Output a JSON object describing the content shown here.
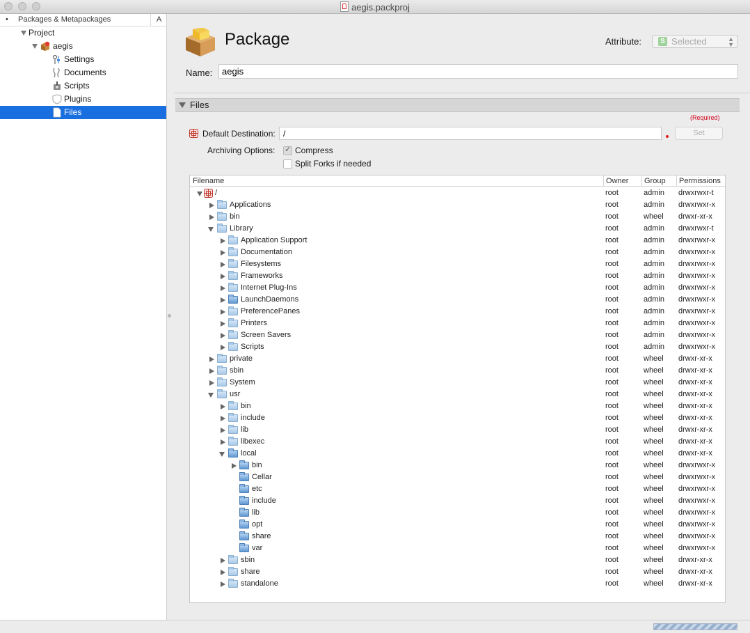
{
  "window": {
    "title": "aegis.packproj"
  },
  "sidebar": {
    "bullet": "•",
    "header": "Packages & Metapackages",
    "sort_label": "A",
    "items": [
      {
        "label": "Project",
        "icon": "disclosure-down"
      },
      {
        "label": "aegis",
        "icon": "package-icon"
      },
      {
        "label": "Settings",
        "icon": "settings-icon"
      },
      {
        "label": "Documents",
        "icon": "documents-icon"
      },
      {
        "label": "Scripts",
        "icon": "scripts-icon"
      },
      {
        "label": "Plugins",
        "icon": "plugins-icon"
      },
      {
        "label": "Files",
        "icon": "file-icon",
        "selected": true
      }
    ]
  },
  "package": {
    "title": "Package",
    "attribute_label": "Attribute:",
    "attribute_badge": "S",
    "attribute_value": "Selected",
    "name_label": "Name:",
    "name_value": "aegis"
  },
  "files": {
    "section_title": "Files",
    "required": "(Required)",
    "default_destination_label": "Default Destination:",
    "default_destination_value": "/",
    "set_button": "Set",
    "archiving_label": "Archiving Options:",
    "compress_label": "Compress",
    "compress_checked": true,
    "split_forks_label": "Split Forks if needed",
    "split_forks_checked": false,
    "columns": {
      "filename": "Filename",
      "owner": "Owner",
      "group": "Group",
      "permissions": "Permissions"
    },
    "rows": [
      {
        "name": "/",
        "level": 0,
        "disc": "down",
        "icon": "root",
        "owner": "root",
        "group": "admin",
        "perm": "drwxrwxr-t"
      },
      {
        "name": "Applications",
        "level": 1,
        "disc": "right",
        "icon": "folder",
        "owner": "root",
        "group": "admin",
        "perm": "drwxrwxr-x"
      },
      {
        "name": "bin",
        "level": 1,
        "disc": "right",
        "icon": "folder",
        "owner": "root",
        "group": "wheel",
        "perm": "drwxr-xr-x"
      },
      {
        "name": "Library",
        "level": 1,
        "disc": "down",
        "icon": "folder",
        "owner": "root",
        "group": "admin",
        "perm": "drwxrwxr-t"
      },
      {
        "name": "Application Support",
        "level": 2,
        "disc": "right",
        "icon": "folder",
        "owner": "root",
        "group": "admin",
        "perm": "drwxrwxr-x"
      },
      {
        "name": "Documentation",
        "level": 2,
        "disc": "right",
        "icon": "folder",
        "owner": "root",
        "group": "admin",
        "perm": "drwxrwxr-x"
      },
      {
        "name": "Filesystems",
        "level": 2,
        "disc": "right",
        "icon": "folder",
        "owner": "root",
        "group": "admin",
        "perm": "drwxrwxr-x"
      },
      {
        "name": "Frameworks",
        "level": 2,
        "disc": "right",
        "icon": "folder",
        "owner": "root",
        "group": "admin",
        "perm": "drwxrwxr-x"
      },
      {
        "name": "Internet Plug-Ins",
        "level": 2,
        "disc": "right",
        "icon": "folder",
        "owner": "root",
        "group": "admin",
        "perm": "drwxrwxr-x"
      },
      {
        "name": "LaunchDaemons",
        "level": 2,
        "disc": "right",
        "icon": "folder-dark",
        "owner": "root",
        "group": "admin",
        "perm": "drwxrwxr-x"
      },
      {
        "name": "PreferencePanes",
        "level": 2,
        "disc": "right",
        "icon": "folder",
        "owner": "root",
        "group": "admin",
        "perm": "drwxrwxr-x"
      },
      {
        "name": "Printers",
        "level": 2,
        "disc": "right",
        "icon": "folder",
        "owner": "root",
        "group": "admin",
        "perm": "drwxrwxr-x"
      },
      {
        "name": "Screen Savers",
        "level": 2,
        "disc": "right",
        "icon": "folder",
        "owner": "root",
        "group": "admin",
        "perm": "drwxrwxr-x"
      },
      {
        "name": "Scripts",
        "level": 2,
        "disc": "right",
        "icon": "folder",
        "owner": "root",
        "group": "admin",
        "perm": "drwxrwxr-x"
      },
      {
        "name": "private",
        "level": 1,
        "disc": "right",
        "icon": "folder",
        "owner": "root",
        "group": "wheel",
        "perm": "drwxr-xr-x"
      },
      {
        "name": "sbin",
        "level": 1,
        "disc": "right",
        "icon": "folder",
        "owner": "root",
        "group": "wheel",
        "perm": "drwxr-xr-x"
      },
      {
        "name": "System",
        "level": 1,
        "disc": "right",
        "icon": "folder",
        "owner": "root",
        "group": "wheel",
        "perm": "drwxr-xr-x"
      },
      {
        "name": "usr",
        "level": 1,
        "disc": "down",
        "icon": "folder",
        "owner": "root",
        "group": "wheel",
        "perm": "drwxr-xr-x"
      },
      {
        "name": "bin",
        "level": 2,
        "disc": "right",
        "icon": "folder",
        "owner": "root",
        "group": "wheel",
        "perm": "drwxr-xr-x"
      },
      {
        "name": "include",
        "level": 2,
        "disc": "right",
        "icon": "folder",
        "owner": "root",
        "group": "wheel",
        "perm": "drwxr-xr-x"
      },
      {
        "name": "lib",
        "level": 2,
        "disc": "right",
        "icon": "folder",
        "owner": "root",
        "group": "wheel",
        "perm": "drwxr-xr-x"
      },
      {
        "name": "libexec",
        "level": 2,
        "disc": "right",
        "icon": "folder",
        "owner": "root",
        "group": "wheel",
        "perm": "drwxr-xr-x"
      },
      {
        "name": "local",
        "level": 2,
        "disc": "down",
        "icon": "folder-dark",
        "owner": "root",
        "group": "wheel",
        "perm": "drwxr-xr-x"
      },
      {
        "name": "bin",
        "level": 3,
        "disc": "right",
        "icon": "folder-dark",
        "owner": "root",
        "group": "wheel",
        "perm": "drwxrwxr-x"
      },
      {
        "name": "Cellar",
        "level": 3,
        "disc": "none",
        "icon": "folder-dark",
        "owner": "root",
        "group": "wheel",
        "perm": "drwxrwxr-x"
      },
      {
        "name": "etc",
        "level": 3,
        "disc": "none",
        "icon": "folder-dark",
        "owner": "root",
        "group": "wheel",
        "perm": "drwxrwxr-x"
      },
      {
        "name": "include",
        "level": 3,
        "disc": "none",
        "icon": "folder-dark",
        "owner": "root",
        "group": "wheel",
        "perm": "drwxrwxr-x"
      },
      {
        "name": "lib",
        "level": 3,
        "disc": "none",
        "icon": "folder-dark",
        "owner": "root",
        "group": "wheel",
        "perm": "drwxrwxr-x"
      },
      {
        "name": "opt",
        "level": 3,
        "disc": "none",
        "icon": "folder-dark",
        "owner": "root",
        "group": "wheel",
        "perm": "drwxrwxr-x"
      },
      {
        "name": "share",
        "level": 3,
        "disc": "none",
        "icon": "folder-dark",
        "owner": "root",
        "group": "wheel",
        "perm": "drwxrwxr-x"
      },
      {
        "name": "var",
        "level": 3,
        "disc": "none",
        "icon": "folder-dark",
        "owner": "root",
        "group": "wheel",
        "perm": "drwxrwxr-x"
      },
      {
        "name": "sbin",
        "level": 2,
        "disc": "right",
        "icon": "folder",
        "owner": "root",
        "group": "wheel",
        "perm": "drwxr-xr-x"
      },
      {
        "name": "share",
        "level": 2,
        "disc": "right",
        "icon": "folder",
        "owner": "root",
        "group": "wheel",
        "perm": "drwxr-xr-x"
      },
      {
        "name": "standalone",
        "level": 2,
        "disc": "right",
        "icon": "folder",
        "owner": "root",
        "group": "wheel",
        "perm": "drwxr-xr-x"
      }
    ]
  },
  "colors": {
    "selection": "#1a6fe0",
    "required": "#d0021b",
    "attribute_badge": "#9fd39b"
  }
}
